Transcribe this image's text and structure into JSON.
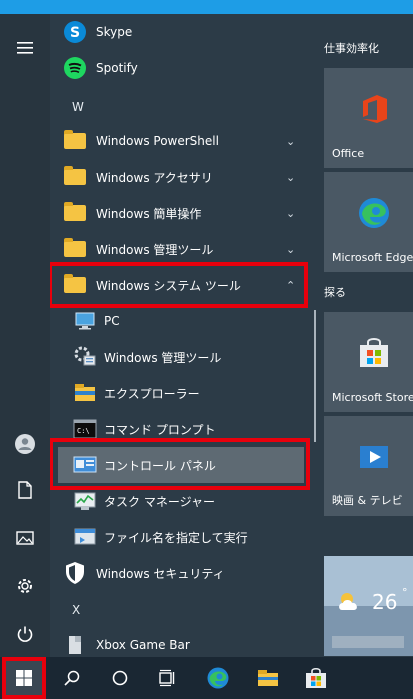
{
  "apps": {
    "skype": "Skype",
    "spotify": "Spotify",
    "letter_w": "W",
    "ps": "Windows PowerShell",
    "accessories": "Windows アクセサリ",
    "ease": "Windows 簡単操作",
    "admin": "Windows 管理ツール",
    "system": "Windows システム ツール",
    "pc": "PC",
    "admin_tools": "Windows 管理ツール",
    "explorer": "エクスプローラー",
    "cmd": "コマンド プロンプト",
    "control_panel": "コントロール パネル",
    "task_manager": "タスク マネージャー",
    "run": "ファイル名を指定して実行",
    "security": "Windows セキュリティ",
    "letter_x": "X",
    "xbox": "Xbox Game Bar"
  },
  "tiles": {
    "group1": "仕事効率化",
    "office": "Office",
    "edge": "Microsoft Edge",
    "group2": "探る",
    "store": "Microsoft Store",
    "movies": "映画 & テレビ",
    "weather_temp": "26"
  },
  "colors": {
    "highlight": "#e8000c",
    "folder": "#f5c443",
    "accent": "#1e9de6"
  }
}
